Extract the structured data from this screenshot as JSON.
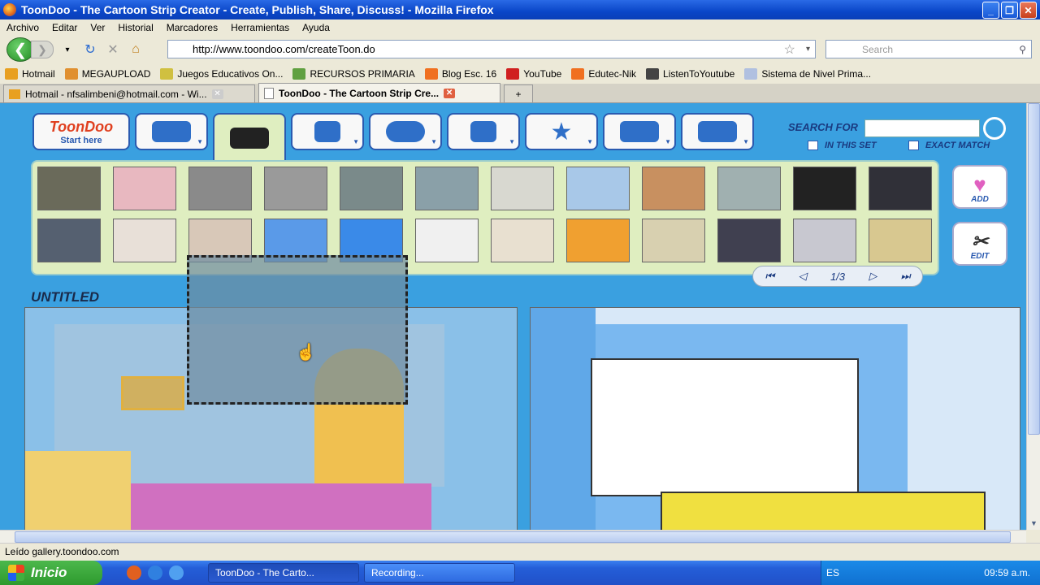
{
  "window": {
    "title": "ToonDoo - The Cartoon Strip Creator - Create, Publish, Share, Discuss! - Mozilla Firefox"
  },
  "menu": [
    "Archivo",
    "Editar",
    "Ver",
    "Historial",
    "Marcadores",
    "Herramientas",
    "Ayuda"
  ],
  "nav": {
    "url": "http://www.toondoo.com/createToon.do",
    "search_placeholder": "Search"
  },
  "bookmarks": [
    {
      "label": "Hotmail",
      "color": "#e8a020"
    },
    {
      "label": "MEGAUPLOAD",
      "color": "#e09030"
    },
    {
      "label": "Juegos Educativos On...",
      "color": "#d0c040"
    },
    {
      "label": "RECURSOS PRIMARIA",
      "color": "#60a040"
    },
    {
      "label": "Blog Esc. 16",
      "color": "#f07020"
    },
    {
      "label": "YouTube",
      "color": "#d02020"
    },
    {
      "label": "Edutec-Nik",
      "color": "#f07020"
    },
    {
      "label": "ListenToYoutube",
      "color": "#444444"
    },
    {
      "label": "Sistema de Nivel Prima...",
      "color": "#b0c0e0"
    }
  ],
  "tabs": [
    {
      "label": "Hotmail - nfsalimbeni@hotmail.com - Wi..."
    },
    {
      "label": "ToonDoo - The Cartoon Strip Cre..."
    }
  ],
  "toondoo": {
    "logo": "ToonDoo",
    "start_here": "Start here",
    "search_for": "SEARCH FOR",
    "in_this_set": "IN THIS SET",
    "exact_match": "EXACT MATCH",
    "add": "ADD",
    "edit": "EDIT",
    "page": "1/3",
    "strip_title": "UNTITLED",
    "thumb_colors": [
      "#6a6a5a",
      "#e8b8c0",
      "#8a8a8a",
      "#9a9a9a",
      "#7a8a8a",
      "#8aa0a8",
      "#d8d8d0",
      "#a8c8e8",
      "#c89060",
      "#a0b0b0",
      "#222222",
      "#303038",
      "#556070",
      "#e8e0d8",
      "#d8c8b8",
      "#5a9ae8",
      "#3a8ae8",
      "#f0f0f0",
      "#e8e0d0",
      "#f0a030",
      "#d8d0b0",
      "#404050",
      "#c8c8d0",
      "#d8c890"
    ]
  },
  "status": "Leído gallery.toondoo.com",
  "taskbar": {
    "start": "Inicio",
    "items": [
      "ToonDoo - The Carto...",
      "Recording..."
    ],
    "lang": "ES",
    "time": "09:59 a.m."
  }
}
